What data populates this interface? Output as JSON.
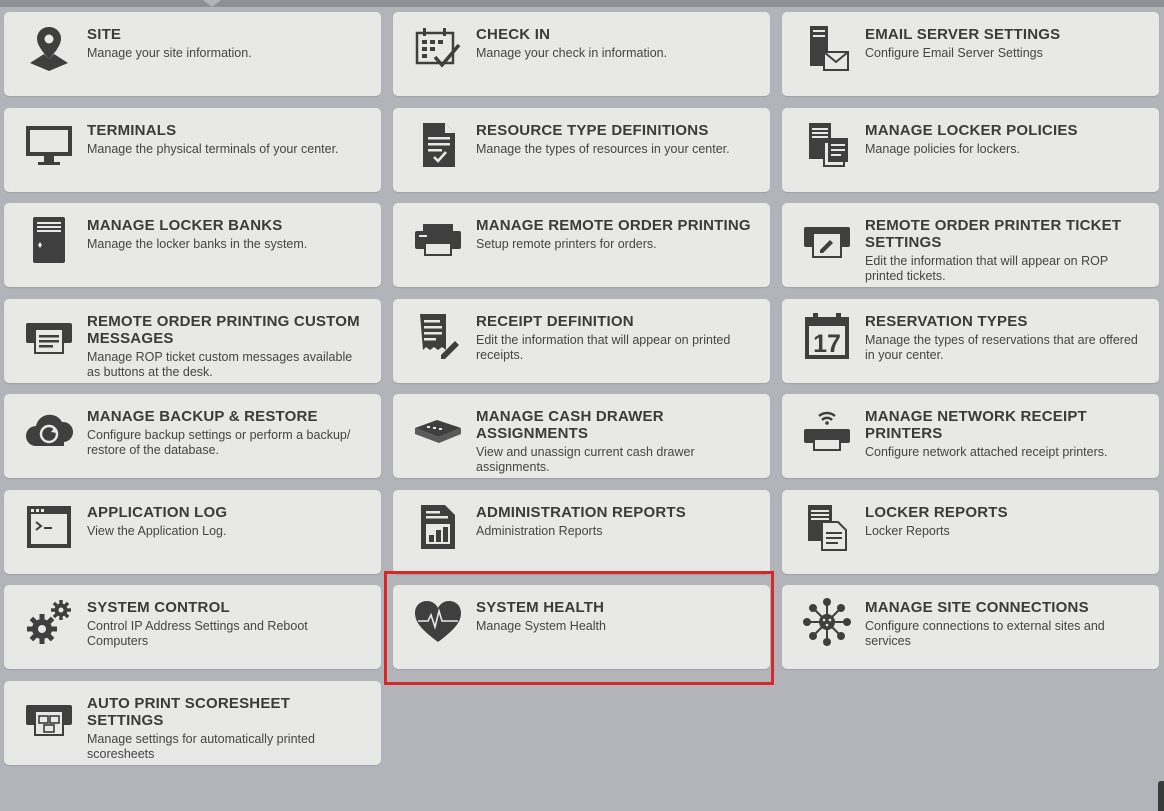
{
  "tiles": [
    {
      "name": "site",
      "icon": "location-pin-icon",
      "title": "SITE",
      "desc": "Manage your site information."
    },
    {
      "name": "check-in",
      "icon": "calendar-check-icon",
      "title": "CHECK IN",
      "desc": "Manage your check in information."
    },
    {
      "name": "email-server-settings",
      "icon": "email-server-icon",
      "title": "EMAIL SERVER SETTINGS",
      "desc": "Configure Email Server Settings"
    },
    {
      "name": "terminals",
      "icon": "monitor-icon",
      "title": "TERMINALS",
      "desc": "Manage the physical terminals of your center."
    },
    {
      "name": "resource-type-definitions",
      "icon": "document-check-icon",
      "title": "RESOURCE TYPE DEFINITIONS",
      "desc": "Manage the types of resources in your center."
    },
    {
      "name": "manage-locker-policies",
      "icon": "locker-policy-icon",
      "title": "MANAGE LOCKER POLICIES",
      "desc": "Manage policies for lockers."
    },
    {
      "name": "manage-locker-banks",
      "icon": "locker-icon",
      "title": "MANAGE LOCKER BANKS",
      "desc": "Manage the locker banks in the system."
    },
    {
      "name": "manage-remote-order-printing",
      "icon": "printer-icon",
      "title": "MANAGE REMOTE ORDER PRINTING",
      "desc": "Setup remote printers for orders."
    },
    {
      "name": "remote-order-printer-ticket-settings",
      "icon": "printer-edit-icon",
      "title": "REMOTE ORDER PRINTER TICKET SETTINGS",
      "desc": "Edit the information that will appear on ROP printed tickets."
    },
    {
      "name": "remote-order-printing-custom-messages",
      "icon": "printer-message-icon",
      "title": "REMOTE ORDER PRINTING CUSTOM MESSAGES",
      "desc": "Manage ROP ticket custom messages available as buttons at the desk."
    },
    {
      "name": "receipt-definition",
      "icon": "receipt-edit-icon",
      "title": "RECEIPT DEFINITION",
      "desc": "Edit the information that will appear on printed receipts."
    },
    {
      "name": "reservation-types",
      "icon": "calendar-17-icon",
      "title": "RESERVATION TYPES",
      "desc": "Manage the types of reservations that are offered in your center."
    },
    {
      "name": "manage-backup-restore",
      "icon": "cloud-sync-icon",
      "title": "MANAGE BACKUP & RESTORE",
      "desc": "Configure backup settings or perform a backup/ restore of the database."
    },
    {
      "name": "manage-cash-drawer-assignments",
      "icon": "cash-drawer-icon",
      "title": "MANAGE CASH DRAWER ASSIGNMENTS",
      "desc": "View and unassign current cash drawer assignments."
    },
    {
      "name": "manage-network-receipt-printers",
      "icon": "network-printer-icon",
      "title": "MANAGE NETWORK RECEIPT PRINTERS",
      "desc": "Configure network attached receipt printers."
    },
    {
      "name": "application-log",
      "icon": "terminal-window-icon",
      "title": "APPLICATION LOG",
      "desc": "View the Application Log."
    },
    {
      "name": "administration-reports",
      "icon": "report-chart-icon",
      "title": "ADMINISTRATION REPORTS",
      "desc": "Administration Reports"
    },
    {
      "name": "locker-reports",
      "icon": "report-documents-icon",
      "title": "LOCKER REPORTS",
      "desc": "Locker Reports"
    },
    {
      "name": "system-control",
      "icon": "gears-icon",
      "title": "SYSTEM CONTROL",
      "desc": "Control IP Address Settings and Reboot Computers"
    },
    {
      "name": "system-health",
      "icon": "heart-pulse-icon",
      "title": "SYSTEM HEALTH",
      "desc": "Manage System Health"
    },
    {
      "name": "manage-site-connections",
      "icon": "network-hub-icon",
      "title": "MANAGE SITE CONNECTIONS",
      "desc": "Configure connections to external sites and services"
    },
    {
      "name": "auto-print-scoresheet-settings",
      "icon": "scoresheet-printer-icon",
      "title": "AUTO PRINT SCORESHEET SETTINGS",
      "desc": "Manage settings for automatically printed scoresheets"
    }
  ],
  "colors": {
    "background": "#b2b4b9",
    "tile": "#e8e8e6",
    "icon": "#3f3f3f",
    "highlight": "#d9282a"
  }
}
